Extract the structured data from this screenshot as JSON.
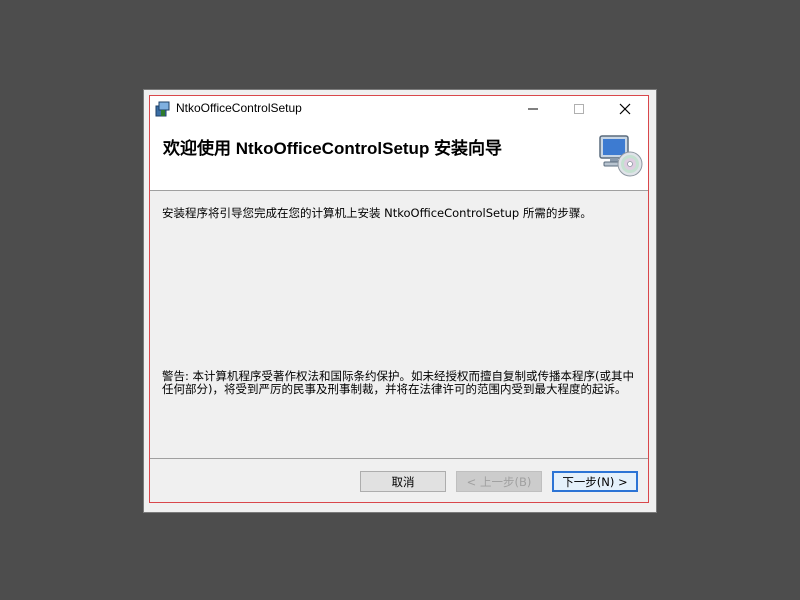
{
  "window": {
    "title": "NtkoOfficeControlSetup"
  },
  "titlebar_buttons": {
    "minimize_icon": "minimize-icon",
    "maximize_icon": "maximize-icon",
    "close_icon": "close-icon"
  },
  "header": {
    "title": "欢迎使用 NtkoOfficeControlSetup 安装向导",
    "icon": "computer-cd-icon"
  },
  "content": {
    "intro": "安装程序将引导您完成在您的计算机上安装 NtkoOfficeControlSetup 所需的步骤。",
    "warning": "警告: 本计算机程序受著作权法和国际条约保护。如未经授权而擅自复制或传播本程序(或其中任何部分)，将受到严厉的民事及刑事制裁，并将在法律许可的范围内受到最大程度的起诉。"
  },
  "buttons": {
    "cancel": "取消",
    "back": "< 上一步(B)",
    "next": "下一步(N) >"
  },
  "colors": {
    "accent_border": "#d9474b",
    "focus_blue": "#2c74d5"
  }
}
